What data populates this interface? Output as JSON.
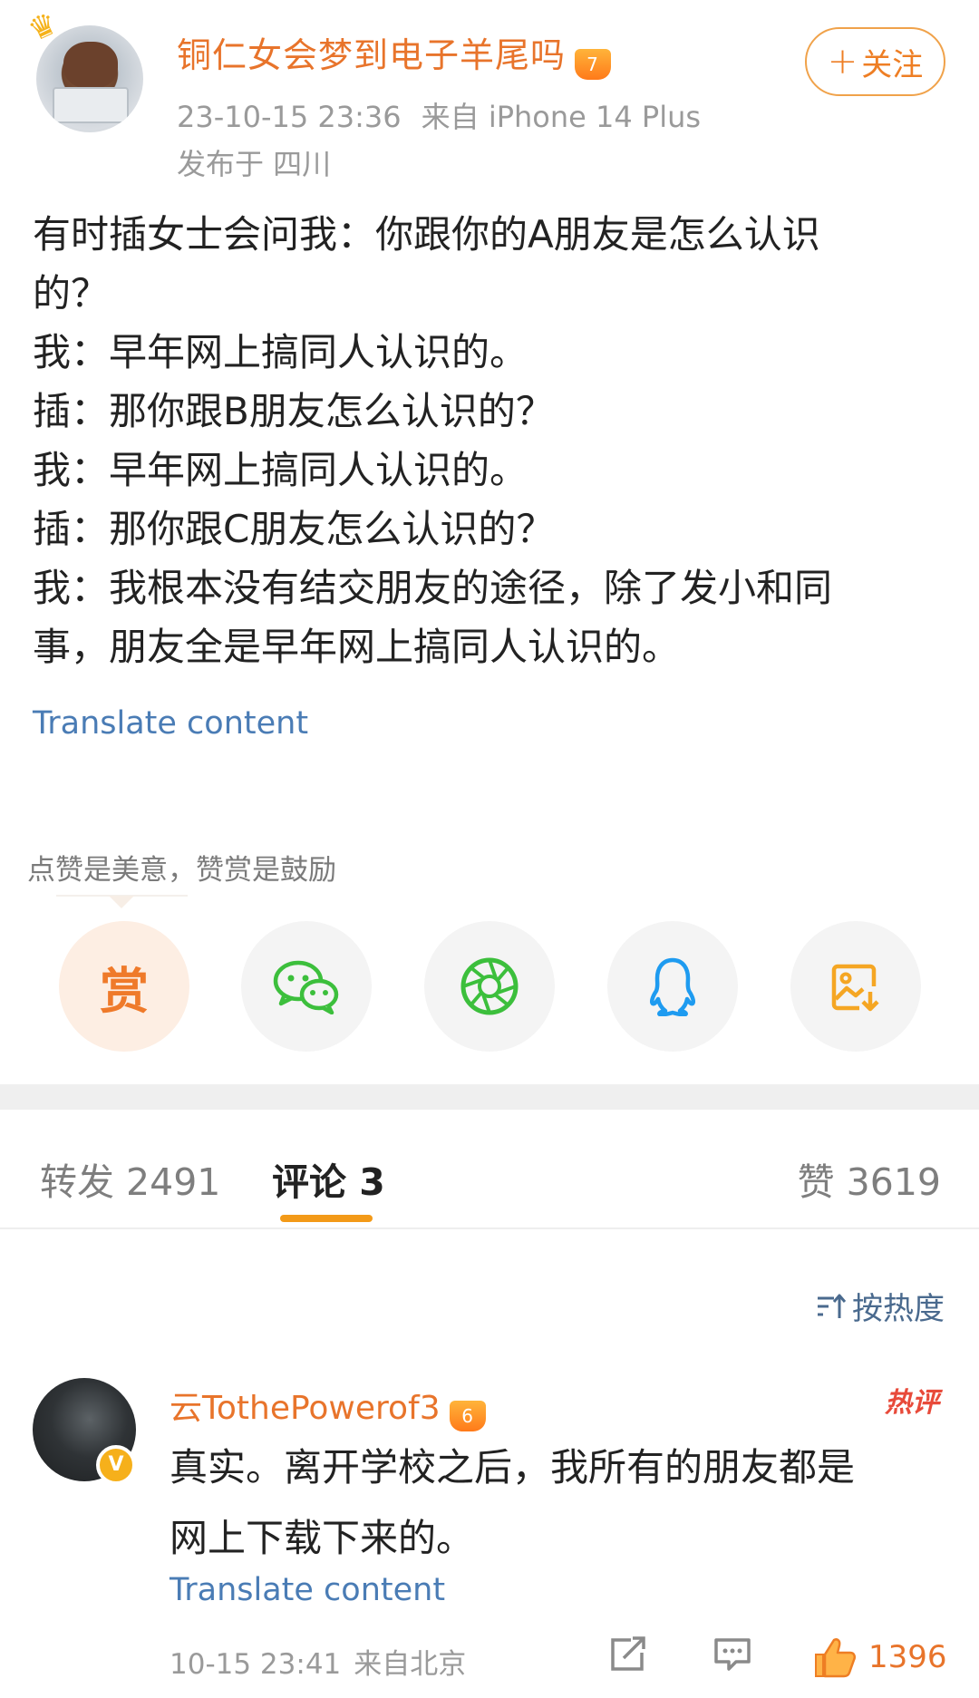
{
  "post": {
    "username": "铜仁女会梦到电子羊尾吗",
    "vip_level": "7",
    "time": "23-10-15 23:36",
    "source": "来自 iPhone 14 Plus",
    "location": "发布于 四川",
    "follow_label": "关注",
    "follow_plus": "+",
    "lines": [
      "有时插女士会问我：你跟你的A朋友是怎么认识",
      "的？",
      "我：早年网上搞同人认识的。",
      "插：那你跟B朋友怎么认识的？",
      "我：早年网上搞同人认识的。",
      "插：那你跟C朋友怎么认识的？",
      "我：我根本没有结交朋友的途径，除了发小和同",
      "事，朋友全是早年网上搞同人认识的。"
    ],
    "translate_label": "Translate content"
  },
  "reward": {
    "hint": "点赞是美意，赞赏是鼓励",
    "button_label": "赏"
  },
  "share_icons": [
    "wechat-icon",
    "moments-icon",
    "qq-icon",
    "save-image-icon"
  ],
  "colors": {
    "accent": "#e8742b",
    "link": "#4a7cb5",
    "tab_underline": "#f39a18",
    "wechat": "#3cbf3c",
    "qq": "#1e9bf0",
    "save": "#f5a623"
  },
  "tabs": {
    "repost": "转发 2491",
    "comments": "评论 3",
    "likes": "赞 3619"
  },
  "sort_label": "按热度",
  "comment": {
    "username": "云TothePowerof3",
    "vip_level": "6",
    "hot_tag": "热评",
    "lines": [
      "真实。离开学校之后，我所有的朋友都是",
      "网上下载下来的。"
    ],
    "translate_label": "Translate content",
    "time": "10-15 23:41",
    "source": "来自北京",
    "like_count": "1396",
    "verify_mark": "V"
  }
}
